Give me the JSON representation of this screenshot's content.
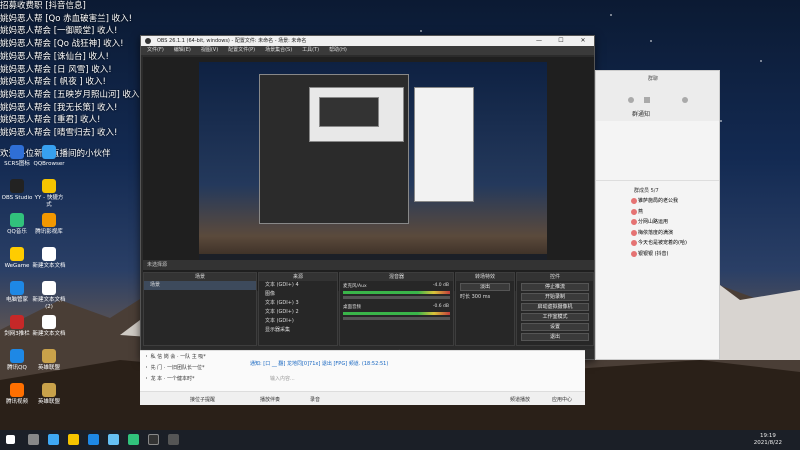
{
  "desktop_text": [
    "招募收费职 [抖音信息]",
    "姚妈恶人帮 [Qo 赤血破害兰] 收入!",
    "姚妈恶人帮会 [一御殿堂] 收人!",
    "姚妈恶人帮会 [Qo 战狂神] 收入!",
    "姚妈恶人帮会 [诛仙台] 收人!",
    "姚妈恶人帮会 [日 风雪] 收入!",
    "姚妈恶人帮会 [ 帆夜 ] 收入!",
    "姚妈恶人帮会 [五映岁月照山河] 收入!",
    "姚妈恶人帮会 [我无长策] 收入!",
    "姚妈恶人帮会 [重君] 收人!",
    "姚妈恶人帮会 [晴雪归去] 收入!",
    "",
    "欢迎各位新进直播间的小伙伴"
  ],
  "desktop_icons": [
    {
      "label": "SCRS图标",
      "color": "#2f6fd6"
    },
    {
      "label": "QQBrowser",
      "color": "#37a0ef"
    },
    {
      "label": "OBS Studio",
      "color": "#222222"
    },
    {
      "label": "YY - 快捷方式",
      "color": "#f5c400"
    },
    {
      "label": "QQ音乐",
      "color": "#31c27c"
    },
    {
      "label": "腾讯影视库",
      "color": "#f39800"
    },
    {
      "label": "WeGame",
      "color": "#ffcc00"
    },
    {
      "label": "新建文本文档",
      "color": "#ffffff"
    },
    {
      "label": "电脑管家",
      "color": "#1e88e5"
    },
    {
      "label": "新建文本文档 (2)",
      "color": "#ffffff"
    },
    {
      "label": "剑网3推栏",
      "color": "#c62828"
    },
    {
      "label": "新建文本文档",
      "color": "#ffffff"
    },
    {
      "label": "腾讯QQ",
      "color": "#1e88e5"
    },
    {
      "label": "英雄联盟",
      "color": "#c9a24a"
    },
    {
      "label": "腾讯视频",
      "color": "#ff6f00"
    },
    {
      "label": "英雄联盟",
      "color": "#c9a24a"
    }
  ],
  "obs": {
    "title": "OBS 26.1.1 (64-bit, windows) - 配置文件: 未命名 - 场景: 未命名",
    "menu": [
      "文件(F)",
      "编辑(E)",
      "视图(V)",
      "配置文件(P)",
      "场景集合(S)",
      "工具(T)",
      "帮助(H)"
    ],
    "no_source": "未选择源",
    "scenes_header": "场景",
    "scenes": [
      "场景"
    ],
    "sources_header": "来源",
    "sources": [
      "文本 (GDI+) 4",
      "图像",
      "文本 (GDI+) 3",
      "文本 (GDI+) 2",
      "文本 (GDI+)",
      "显示器采集"
    ],
    "mixer_header": "混音器",
    "mixer": [
      {
        "name": "麦克风/Aux",
        "db": "-4.0 dB"
      },
      {
        "name": "桌面音频",
        "db": "-0.6 dB"
      }
    ],
    "transition_header": "转场特效",
    "transition_value": "淡出",
    "duration_label": "时长",
    "duration_value": "300 ms",
    "controls_header": "控件",
    "controls": [
      "停止推流",
      "开始录制",
      "启动虚拟摄像机",
      "工作室模式",
      "设置",
      "退出"
    ],
    "status": {
      "dropped": "丢帧 0 (0.0%)",
      "live": "LIVE: 00:00:00",
      "rec": "REC: 00:00:00",
      "cpu": "CPU: 0.0%, 60.00 fps",
      "kbps": "0 kb/s"
    }
  },
  "qq": {
    "title": "群聊",
    "notice_label": "群通知",
    "members_label": "群成员 5/7",
    "messages": [
      "锥萨施局的老公我",
      "燕",
      "分网山路运用",
      "梅依落度的满演",
      "今天也是被宠着的(哈)",
      "银银银 (抖音)"
    ]
  },
  "chat": {
    "lines": [
      "・ 私 信 岗 会 · 一队 主 吸*",
      "・ 先 门 · 一旧团队长一位*",
      "・ 龙 本 · 一个健本时*"
    ],
    "notice": "通知: [口 __ 翻] 龙地同[0]71x] 退出 [FPG] 频道. (18:52:51)",
    "input_placeholder": "输入内容...",
    "toolbar": [
      "接位子提醒",
      "播放伴奏",
      "录音"
    ],
    "right_tools": [
      "频道播放",
      "应用中心"
    ]
  },
  "taskbar": {
    "time": "19:19",
    "date": "2021/8/22"
  },
  "colors": {
    "desktop_bg": "#132a52",
    "obs_dark": "#2b2b2b",
    "accent_red": "#c23b3b"
  }
}
